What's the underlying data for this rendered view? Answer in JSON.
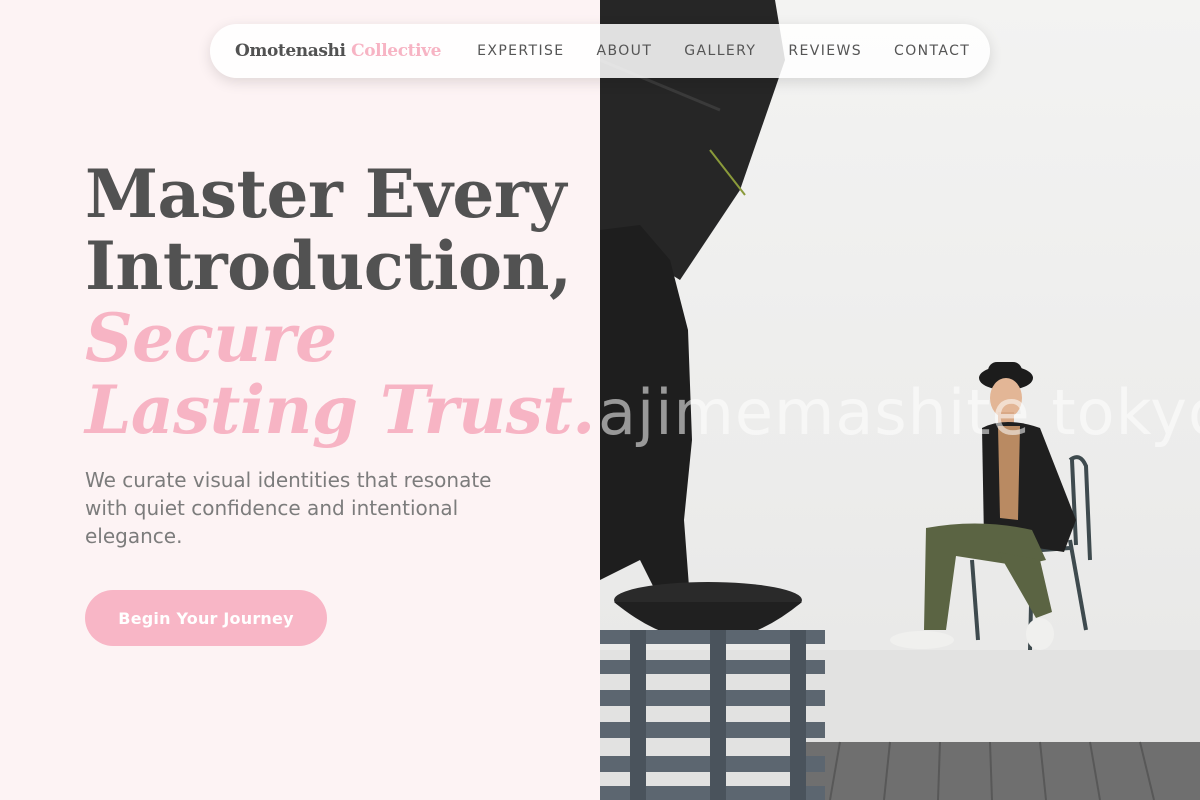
{
  "nav": {
    "brand_primary": "Omotenashi",
    "brand_accent": "Collective",
    "links": [
      {
        "label": "EXPERTISE"
      },
      {
        "label": "ABOUT"
      },
      {
        "label": "GALLERY"
      },
      {
        "label": "REVIEWS"
      },
      {
        "label": "CONTACT"
      }
    ]
  },
  "hero": {
    "headline_line1": "Master Every",
    "headline_line2": "Introduction,",
    "headline_accent_line1": "Secure",
    "headline_accent_line2": "Lasting Trust.",
    "subtitle": "We curate visual identities that resonate with quiet confidence and intentional elegance.",
    "cta_label": "Begin Your Journey"
  },
  "photo": {
    "watermark": "ajimemashite tokyo",
    "alt_description": "Photo studio with a man in a hat seated on a chair beside a black umbrella light and stacked wooden pallets"
  },
  "colors": {
    "background": "#fdf3f4",
    "text_dark": "#525252",
    "accent_pink": "#f7b4c4",
    "button_pink": "#f8b6c6",
    "subtitle_gray": "#7c7c7c"
  }
}
